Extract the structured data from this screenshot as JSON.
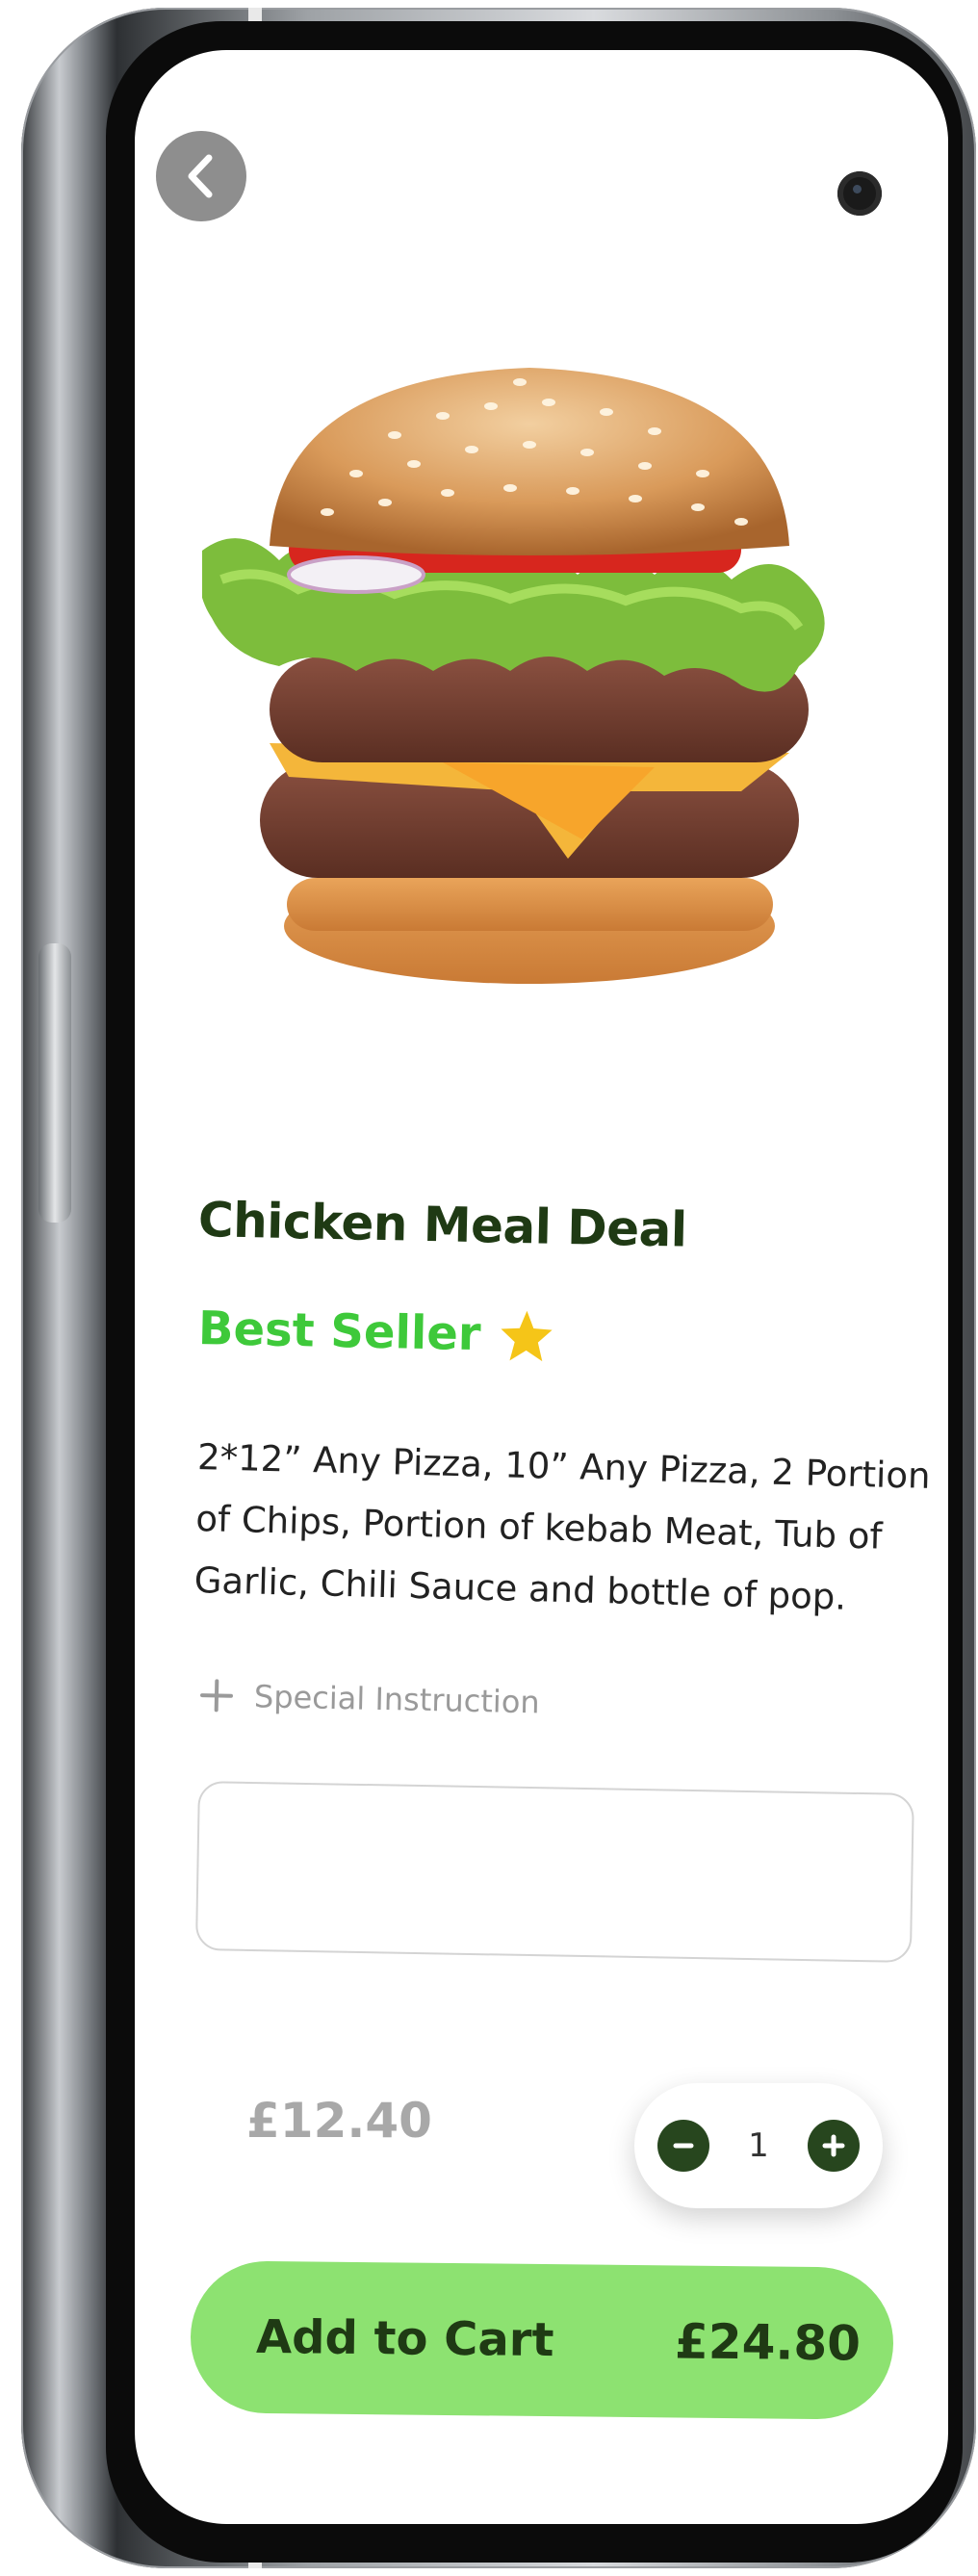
{
  "product": {
    "title": "Chicken Meal Deal",
    "badge": "Best Seller",
    "description": "2*12” Any Pizza, 10” Any Pizza, 2 Portion of Chips, Portion of kebab Meat, Tub of Garlic, Chili Sauce and bottle of pop.",
    "image": "burger-image"
  },
  "special_instruction": {
    "label": "Special Instruction",
    "value": "",
    "placeholder": ""
  },
  "pricing": {
    "unit_price": "£12.40",
    "quantity": "1",
    "total": "£24.80"
  },
  "cart": {
    "label": "Add to Cart"
  },
  "colors": {
    "accent_green": "#8de271",
    "badge_green": "#3ec93a",
    "dark_green": "#27461e",
    "star": "#f5c518"
  },
  "icons": [
    "back-arrow-icon",
    "star-icon",
    "plus-icon",
    "minus-icon",
    "camera-icon"
  ]
}
